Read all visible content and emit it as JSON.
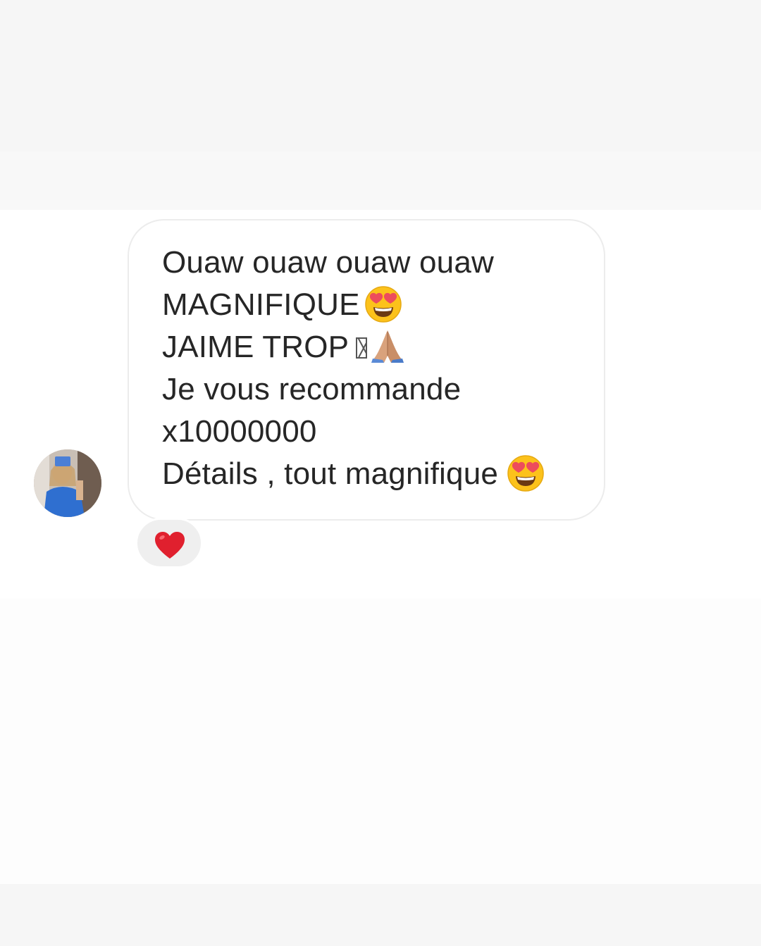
{
  "message": {
    "lines": [
      "Ouaw ouaw ouaw ouaw",
      "MAGNIFIQUE",
      "JAIME TROP",
      "Je vous recommande",
      "x10000000",
      "Détails , tout magnifique"
    ],
    "emojis": {
      "line2": "heart-eyes-emoji",
      "line3": "praying-hands-emoji",
      "line6": "heart-eyes-emoji"
    }
  },
  "reaction": {
    "icon": "red-heart-icon"
  },
  "avatar": {
    "icon": "avatar"
  },
  "colors": {
    "bubble_border": "#ececec",
    "text": "#262626",
    "reaction_bg": "#efefef",
    "heart": "#e0202e"
  }
}
